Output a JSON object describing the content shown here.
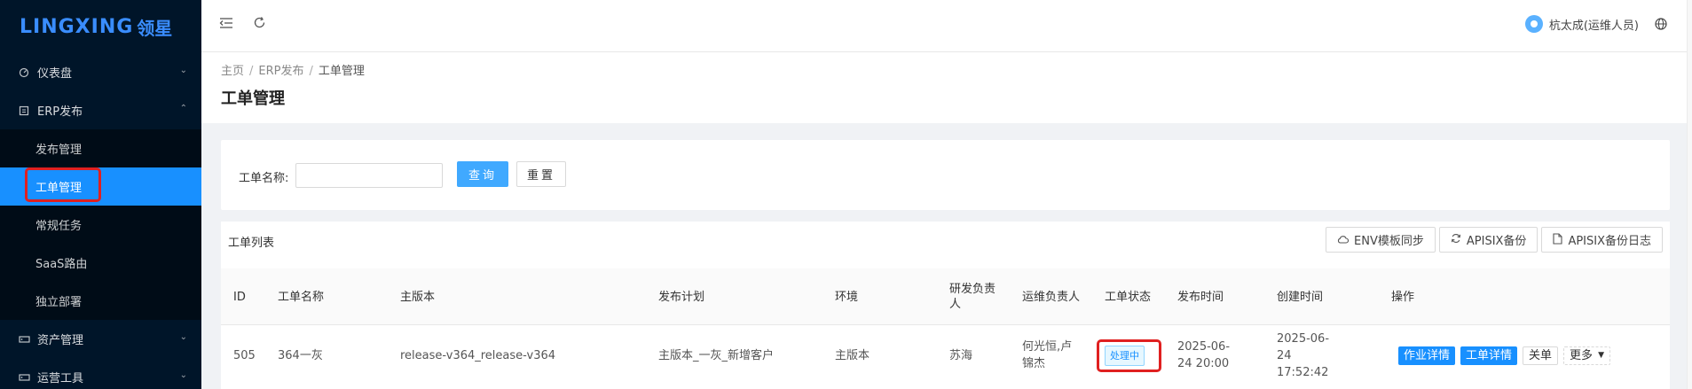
{
  "sidebar": {
    "logo_latin": "LINGXING",
    "logo_cn": "领星",
    "menu": [
      {
        "label": "仪表盘",
        "icon": "dashboard-icon",
        "expanded": false
      },
      {
        "label": "ERP发布",
        "icon": "document-icon",
        "expanded": true
      },
      {
        "label": "资产管理",
        "icon": "server-icon",
        "expanded": false
      },
      {
        "label": "运营工具",
        "icon": "server-icon",
        "expanded": false
      }
    ],
    "submenu": [
      "发布管理",
      "工单管理",
      "常规任务",
      "SaaS路由",
      "独立部署"
    ],
    "active_sub": "工单管理"
  },
  "header": {
    "user_name": "杭太成(运维人员)",
    "icons": [
      "menu-fold-icon",
      "refresh-icon",
      "globe-icon"
    ]
  },
  "breadcrumb": [
    "主页",
    "ERP发布",
    "工单管理"
  ],
  "page_title": "工单管理",
  "search": {
    "label": "工单名称:",
    "value": "",
    "placeholder": "",
    "query_label": "查询",
    "reset_label": "重置"
  },
  "table": {
    "title": "工单列表",
    "tools": [
      {
        "label": "ENV模板同步",
        "icon": "cloud-icon"
      },
      {
        "label": "APISIX备份",
        "icon": "sync-icon"
      },
      {
        "label": "APISIX备份日志",
        "icon": "file-icon"
      }
    ],
    "columns": [
      "ID",
      "工单名称",
      "主版本",
      "发布计划",
      "环境",
      "研发负责人",
      "运维负责人",
      "工单状态",
      "发布时间",
      "创建时间",
      "操作"
    ],
    "rows": [
      {
        "id": "505",
        "name": "364一灰",
        "version": "release-v364_release-v364",
        "plan": "主版本_一灰_新增客户",
        "env": "主版本",
        "dev_owner": "苏海",
        "ops_owner": "何光恒,卢锦杰",
        "status": "处理中",
        "publish_time": "2025-06-24 20:00",
        "create_time": "2025-06-24 17:52:42",
        "actions": {
          "job_detail": "作业详情",
          "order_detail": "工单详情",
          "close": "关单",
          "more": "更多"
        }
      }
    ]
  },
  "colors": {
    "sidebar_bg": "#001529",
    "primary": "#1890ff",
    "highlight": "#e02020"
  }
}
